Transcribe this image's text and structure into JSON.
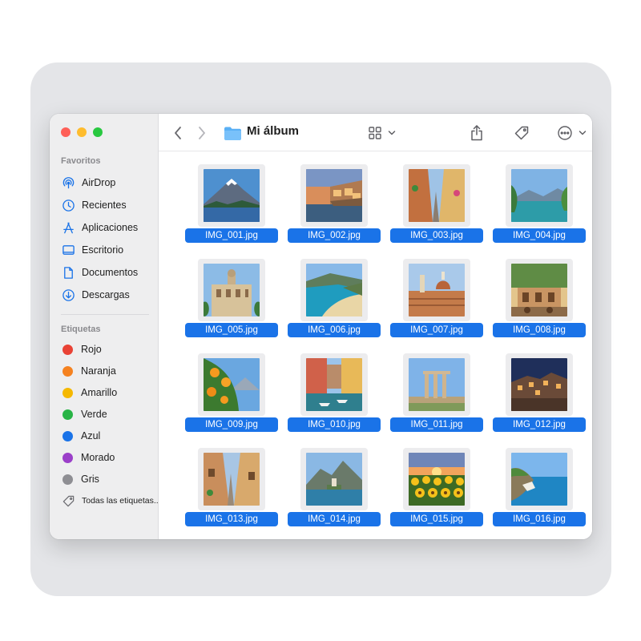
{
  "window": {
    "title": "Mi álbum"
  },
  "sidebar": {
    "favorites_title": "Favoritos",
    "favorites": [
      {
        "label": "AirDrop",
        "icon": "airdrop-icon"
      },
      {
        "label": "Recientes",
        "icon": "clock-icon"
      },
      {
        "label": "Aplicaciones",
        "icon": "applications-icon"
      },
      {
        "label": "Escritorio",
        "icon": "desktop-icon"
      },
      {
        "label": "Documentos",
        "icon": "document-icon"
      },
      {
        "label": "Descargas",
        "icon": "download-icon"
      }
    ],
    "tags_title": "Etiquetas",
    "tags": [
      {
        "label": "Rojo",
        "color": "#e94235"
      },
      {
        "label": "Naranja",
        "color": "#f58220"
      },
      {
        "label": "Amarillo",
        "color": "#f5b800"
      },
      {
        "label": "Verde",
        "color": "#28b446"
      },
      {
        "label": "Azul",
        "color": "#1a73e8"
      },
      {
        "label": "Morado",
        "color": "#9b3fc9"
      },
      {
        "label": "Gris",
        "color": "#8e8e93"
      }
    ],
    "all_tags_label": "Todas las etiquetas..."
  },
  "files": [
    {
      "name": "IMG_001.jpg",
      "scene": "mountain-lake"
    },
    {
      "name": "IMG_002.jpg",
      "scene": "coastal-town-dusk"
    },
    {
      "name": "IMG_003.jpg",
      "scene": "narrow-street"
    },
    {
      "name": "IMG_004.jpg",
      "scene": "lake-mountains"
    },
    {
      "name": "IMG_005.jpg",
      "scene": "baroque-building"
    },
    {
      "name": "IMG_006.jpg",
      "scene": "beach-cove"
    },
    {
      "name": "IMG_007.jpg",
      "scene": "city-dome"
    },
    {
      "name": "IMG_008.jpg",
      "scene": "piazza-cafe"
    },
    {
      "name": "IMG_009.jpg",
      "scene": "orange-tree"
    },
    {
      "name": "IMG_010.jpg",
      "scene": "canal-boats"
    },
    {
      "name": "IMG_011.jpg",
      "scene": "ancient-temple"
    },
    {
      "name": "IMG_012.jpg",
      "scene": "hilltop-town-night"
    },
    {
      "name": "IMG_013.jpg",
      "scene": "alley-street"
    },
    {
      "name": "IMG_014.jpg",
      "scene": "lake-island"
    },
    {
      "name": "IMG_015.jpg",
      "scene": "sunflower-field"
    },
    {
      "name": "IMG_016.jpg",
      "scene": "rocky-coast"
    }
  ],
  "colors": {
    "selection": "#1a73e8",
    "folder": "#5ab0f5"
  }
}
